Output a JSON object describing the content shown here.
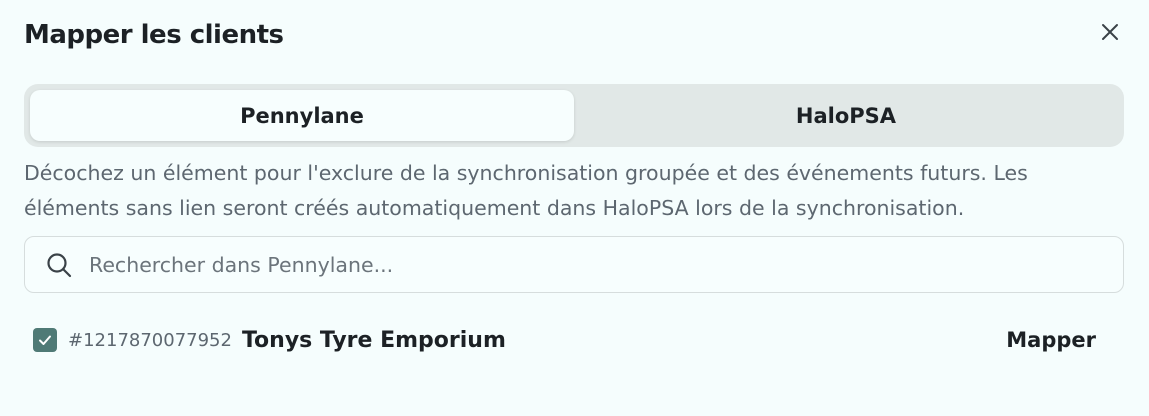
{
  "dialog": {
    "title": "Mapper les clients",
    "close_icon": "close-icon"
  },
  "tabs": [
    {
      "label": "Pennylane",
      "active": true
    },
    {
      "label": "HaloPSA",
      "active": false
    }
  ],
  "description": "Décochez un élément pour l'exclure de la synchronisation groupée et des événements futurs. Les éléments sans lien seront créés automatiquement dans HaloPSA lors de la synchronisation.",
  "search": {
    "placeholder": "Rechercher dans Pennylane...",
    "value": "",
    "icon": "search-icon"
  },
  "clients": [
    {
      "checked": true,
      "id": "#1217870077952",
      "name": "Tonys Tyre Emporium",
      "action_label": "Mapper"
    }
  ],
  "colors": {
    "background": "#f5fdfd",
    "tab_track": "#e1e8e7",
    "checkbox": "#4f7a76",
    "muted_text": "#5d6770"
  }
}
